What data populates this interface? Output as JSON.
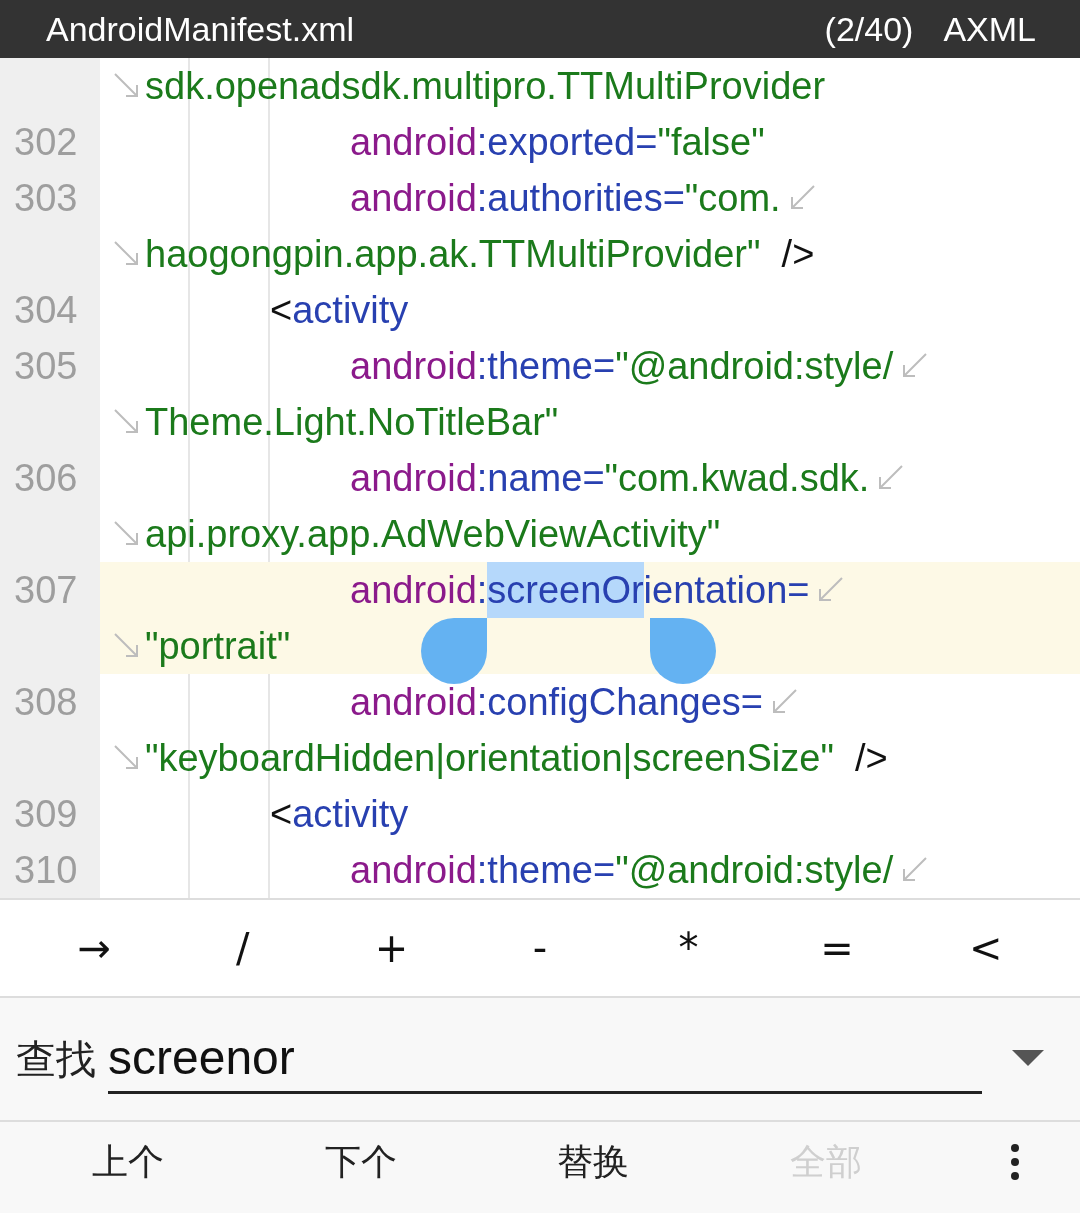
{
  "header": {
    "title": "AndroidManifest.xml",
    "position": "(2/40)",
    "mode": "AXML"
  },
  "code_lines": [
    {
      "kind": "continuation",
      "wraps": false,
      "current": false,
      "segments": [
        {
          "kind": "value",
          "text": "sdk.openadsdk.multipro.TTMultiProvider"
        }
      ]
    },
    {
      "number": "302",
      "kind": "attribute",
      "wraps": false,
      "current": false,
      "segments": [
        {
          "kind": "ns",
          "text": "android"
        },
        {
          "kind": "attr",
          "text": ":exported="
        },
        {
          "kind": "value",
          "text": "\"false\""
        }
      ]
    },
    {
      "number": "303",
      "kind": "attribute",
      "wraps": true,
      "current": false,
      "segments": [
        {
          "kind": "ns",
          "text": "android"
        },
        {
          "kind": "attr",
          "text": ":authorities="
        },
        {
          "kind": "value",
          "text": "\"com."
        }
      ]
    },
    {
      "kind": "continuation",
      "wraps": false,
      "current": false,
      "segments": [
        {
          "kind": "value",
          "text": "haogongpin.app.ak.TTMultiProvider\""
        },
        {
          "kind": "punct",
          "text": "  />"
        }
      ]
    },
    {
      "number": "304",
      "kind": "element",
      "wraps": false,
      "current": false,
      "segments": [
        {
          "kind": "punct",
          "text": "<"
        },
        {
          "kind": "tag",
          "text": "activity"
        }
      ]
    },
    {
      "number": "305",
      "kind": "attribute",
      "wraps": true,
      "current": false,
      "segments": [
        {
          "kind": "ns",
          "text": "android"
        },
        {
          "kind": "attr",
          "text": ":theme="
        },
        {
          "kind": "value",
          "text": "\"@android:style/"
        }
      ]
    },
    {
      "kind": "continuation",
      "wraps": false,
      "current": false,
      "segments": [
        {
          "kind": "value",
          "text": "Theme.Light.NoTitleBar\""
        }
      ]
    },
    {
      "number": "306",
      "kind": "attribute",
      "wraps": true,
      "current": false,
      "segments": [
        {
          "kind": "ns",
          "text": "android"
        },
        {
          "kind": "attr",
          "text": ":name="
        },
        {
          "kind": "value",
          "text": "\"com.kwad.sdk."
        }
      ]
    },
    {
      "kind": "continuation",
      "wraps": false,
      "current": false,
      "segments": [
        {
          "kind": "value",
          "text": "api.proxy.app.AdWebViewActivity\""
        }
      ]
    },
    {
      "number": "307",
      "kind": "attribute",
      "wraps": true,
      "current": true,
      "segments": [
        {
          "kind": "ns",
          "text": "android"
        },
        {
          "kind": "attr",
          "text": ":"
        },
        {
          "kind": "selection",
          "text": "screenOr"
        },
        {
          "kind": "attr",
          "text": "ientation="
        }
      ]
    },
    {
      "kind": "continuation",
      "wraps": false,
      "current": true,
      "segments": [
        {
          "kind": "value",
          "text": "\"portrait\""
        }
      ]
    },
    {
      "number": "308",
      "kind": "attribute",
      "wraps": true,
      "current": false,
      "segments": [
        {
          "kind": "ns",
          "text": "android"
        },
        {
          "kind": "attr",
          "text": ":configChanges="
        }
      ]
    },
    {
      "kind": "continuation",
      "wraps": false,
      "current": false,
      "segments": [
        {
          "kind": "value",
          "text": "\"keyboardHidden|orientation|screenSize\""
        },
        {
          "kind": "punct",
          "text": "  />"
        }
      ]
    },
    {
      "number": "309",
      "kind": "element",
      "wraps": false,
      "current": false,
      "segments": [
        {
          "kind": "punct",
          "text": "<"
        },
        {
          "kind": "tag",
          "text": "activity"
        }
      ]
    },
    {
      "number": "310",
      "kind": "attribute",
      "wraps": true,
      "current": false,
      "segments": [
        {
          "kind": "ns",
          "text": "android"
        },
        {
          "kind": "attr",
          "text": ":theme="
        },
        {
          "kind": "value",
          "text": "\"@android:style/"
        }
      ]
    }
  ],
  "symbol_keys": [
    "→",
    "/",
    "+",
    "-",
    "*",
    "=",
    "<"
  ],
  "find": {
    "label": "查找",
    "value": "screenor"
  },
  "actions": [
    {
      "label": "上个",
      "disabled": false
    },
    {
      "label": "下个",
      "disabled": false
    },
    {
      "label": "替换",
      "disabled": false
    },
    {
      "label": "全部",
      "disabled": true
    }
  ]
}
